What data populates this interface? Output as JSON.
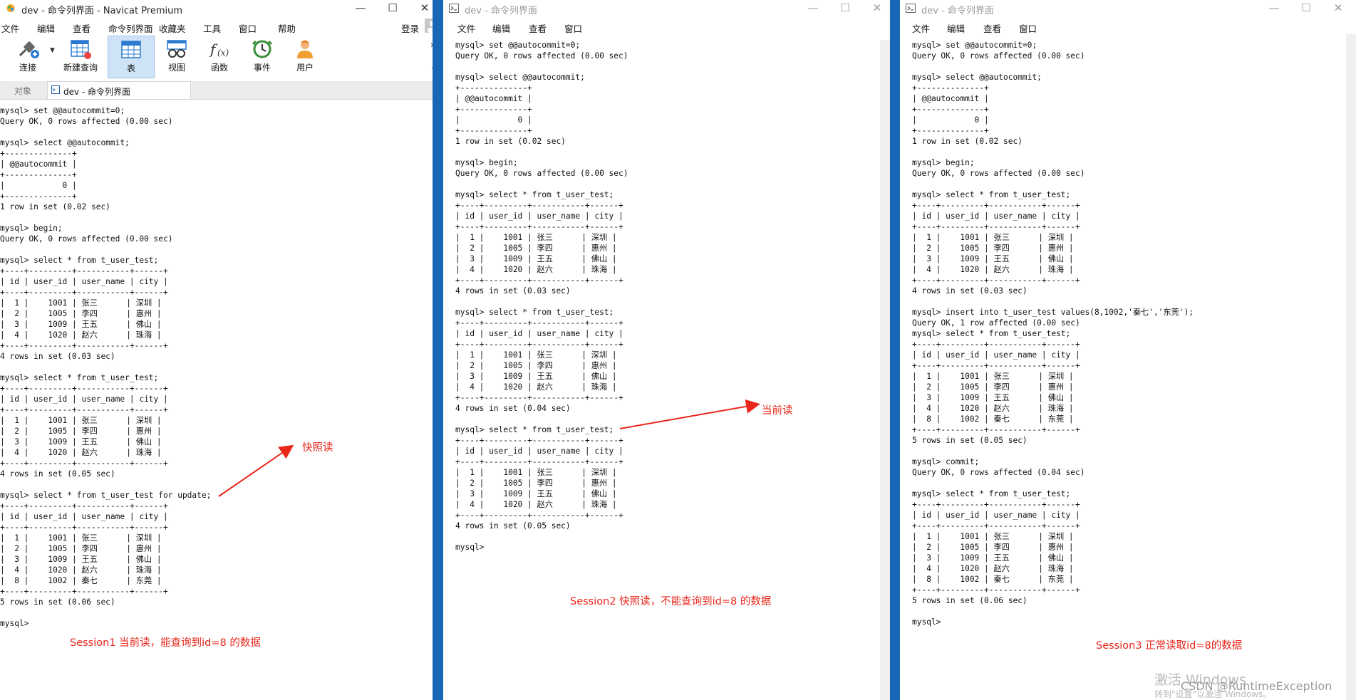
{
  "window1": {
    "title": "dev - 命令列界面 - Navicat Premium",
    "controls": {
      "minimize": "—",
      "maximize": "☐",
      "close": "✕"
    },
    "menu": [
      "文件",
      "编辑",
      "查看",
      "命令列界面",
      "收藏夹",
      "工具",
      "窗口",
      "帮助"
    ],
    "login": "登录",
    "toolbar": [
      "连接",
      "新建查询",
      "表",
      "视图",
      "函数",
      "事件",
      "用户"
    ],
    "tabs": {
      "objects": "对象",
      "active": "dev - 命令列界面"
    },
    "console": "mysql> set @@autocommit=0;\nQuery OK, 0 rows affected (0.00 sec)\n\nmysql> select @@autocommit;\n+--------------+\n| @@autocommit |\n+--------------+\n|            0 |\n+--------------+\n1 row in set (0.02 sec)\n\nmysql> begin;\nQuery OK, 0 rows affected (0.00 sec)\n\nmysql> select * from t_user_test;\n+----+---------+-----------+------+\n| id | user_id | user_name | city |\n+----+---------+-----------+------+\n|  1 |    1001 | 张三      | 深圳 |\n|  2 |    1005 | 李四      | 惠州 |\n|  3 |    1009 | 王五      | 佛山 |\n|  4 |    1020 | 赵六      | 珠海 |\n+----+---------+-----------+------+\n4 rows in set (0.03 sec)\n\nmysql> select * from t_user_test;\n+----+---------+-----------+------+\n| id | user_id | user_name | city |\n+----+---------+-----------+------+\n|  1 |    1001 | 张三      | 深圳 |\n|  2 |    1005 | 李四      | 惠州 |\n|  3 |    1009 | 王五      | 佛山 |\n|  4 |    1020 | 赵六      | 珠海 |\n+----+---------+-----------+------+\n4 rows in set (0.05 sec)\n\nmysql> select * from t_user_test for update;\n+----+---------+-----------+------+\n| id | user_id | user_name | city |\n+----+---------+-----------+------+\n|  1 |    1001 | 张三      | 深圳 |\n|  2 |    1005 | 李四      | 惠州 |\n|  3 |    1009 | 王五      | 佛山 |\n|  4 |    1020 | 赵六      | 珠海 |\n|  8 |    1002 | 秦七      | 东莞 |\n+----+---------+-----------+------+\n5 rows in set (0.06 sec)\n\nmysql>"
  },
  "window2": {
    "title": "dev - 命令列界面",
    "controls": {
      "minimize": "—",
      "maximize": "☐",
      "close": "✕"
    },
    "menu": [
      "文件",
      "编辑",
      "查看",
      "窗口"
    ],
    "console": "mysql> set @@autocommit=0;\nQuery OK, 0 rows affected (0.00 sec)\n\nmysql> select @@autocommit;\n+--------------+\n| @@autocommit |\n+--------------+\n|            0 |\n+--------------+\n1 row in set (0.02 sec)\n\nmysql> begin;\nQuery OK, 0 rows affected (0.00 sec)\n\nmysql> select * from t_user_test;\n+----+---------+-----------+------+\n| id | user_id | user_name | city |\n+----+---------+-----------+------+\n|  1 |    1001 | 张三      | 深圳 |\n|  2 |    1005 | 李四      | 惠州 |\n|  3 |    1009 | 王五      | 佛山 |\n|  4 |    1020 | 赵六      | 珠海 |\n+----+---------+-----------+------+\n4 rows in set (0.03 sec)\n\nmysql> select * from t_user_test;\n+----+---------+-----------+------+\n| id | user_id | user_name | city |\n+----+---------+-----------+------+\n|  1 |    1001 | 张三      | 深圳 |\n|  2 |    1005 | 李四      | 惠州 |\n|  3 |    1009 | 王五      | 佛山 |\n|  4 |    1020 | 赵六      | 珠海 |\n+----+---------+-----------+------+\n4 rows in set (0.04 sec)\n\nmysql> select * from t_user_test;\n+----+---------+-----------+------+\n| id | user_id | user_name | city |\n+----+---------+-----------+------+\n|  1 |    1001 | 张三      | 深圳 |\n|  2 |    1005 | 李四      | 惠州 |\n|  3 |    1009 | 王五      | 佛山 |\n|  4 |    1020 | 赵六      | 珠海 |\n+----+---------+-----------+------+\n4 rows in set (0.05 sec)\n\nmysql>"
  },
  "window3": {
    "title": "dev - 命令列界面",
    "controls": {
      "minimize": "—",
      "maximize": "☐",
      "close": "✕"
    },
    "menu": [
      "文件",
      "编辑",
      "查看",
      "窗口"
    ],
    "console": "mysql> set @@autocommit=0;\nQuery OK, 0 rows affected (0.00 sec)\n\nmysql> select @@autocommit;\n+--------------+\n| @@autocommit |\n+--------------+\n|            0 |\n+--------------+\n1 row in set (0.02 sec)\n\nmysql> begin;\nQuery OK, 0 rows affected (0.00 sec)\n\nmysql> select * from t_user_test;\n+----+---------+-----------+------+\n| id | user_id | user_name | city |\n+----+---------+-----------+------+\n|  1 |    1001 | 张三      | 深圳 |\n|  2 |    1005 | 李四      | 惠州 |\n|  3 |    1009 | 王五      | 佛山 |\n|  4 |    1020 | 赵六      | 珠海 |\n+----+---------+-----------+------+\n4 rows in set (0.03 sec)\n\nmysql> insert into t_user_test values(8,1002,'秦七','东莞');\nQuery OK, 1 row affected (0.00 sec)\nmysql> select * from t_user_test;\n+----+---------+-----------+------+\n| id | user_id | user_name | city |\n+----+---------+-----------+------+\n|  1 |    1001 | 张三      | 深圳 |\n|  2 |    1005 | 李四      | 惠州 |\n|  3 |    1009 | 王五      | 佛山 |\n|  4 |    1020 | 赵六      | 珠海 |\n|  8 |    1002 | 秦七      | 东莞 |\n+----+---------+-----------+------+\n5 rows in set (0.05 sec)\n\nmysql> commit;\nQuery OK, 0 rows affected (0.04 sec)\n\nmysql> select * from t_user_test;\n+----+---------+-----------+------+\n| id | user_id | user_name | city |\n+----+---------+-----------+------+\n|  1 |    1001 | 张三      | 深圳 |\n|  2 |    1005 | 李四      | 惠州 |\n|  3 |    1009 | 王五      | 佛山 |\n|  4 |    1020 | 赵六      | 珠海 |\n|  8 |    1002 | 秦七      | 东莞 |\n+----+---------+-----------+------+\n5 rows in set (0.06 sec)\n\nmysql>"
  },
  "annotations": {
    "snapshot_read": "快照读",
    "current_read": "当前读",
    "session1": "Session1 当前读，能查询到id=8 的数据",
    "session2": "Session2 快照读，不能查询到id=8 的数据",
    "session3": "Session3 正常读取id=8的数据",
    "color": "#e8261a"
  },
  "watermark": {
    "activate": "激活 Windows",
    "activate_sub": "转到\"设置\"以激活 Windows。",
    "csdn": "CSDN @RuntimeException"
  }
}
